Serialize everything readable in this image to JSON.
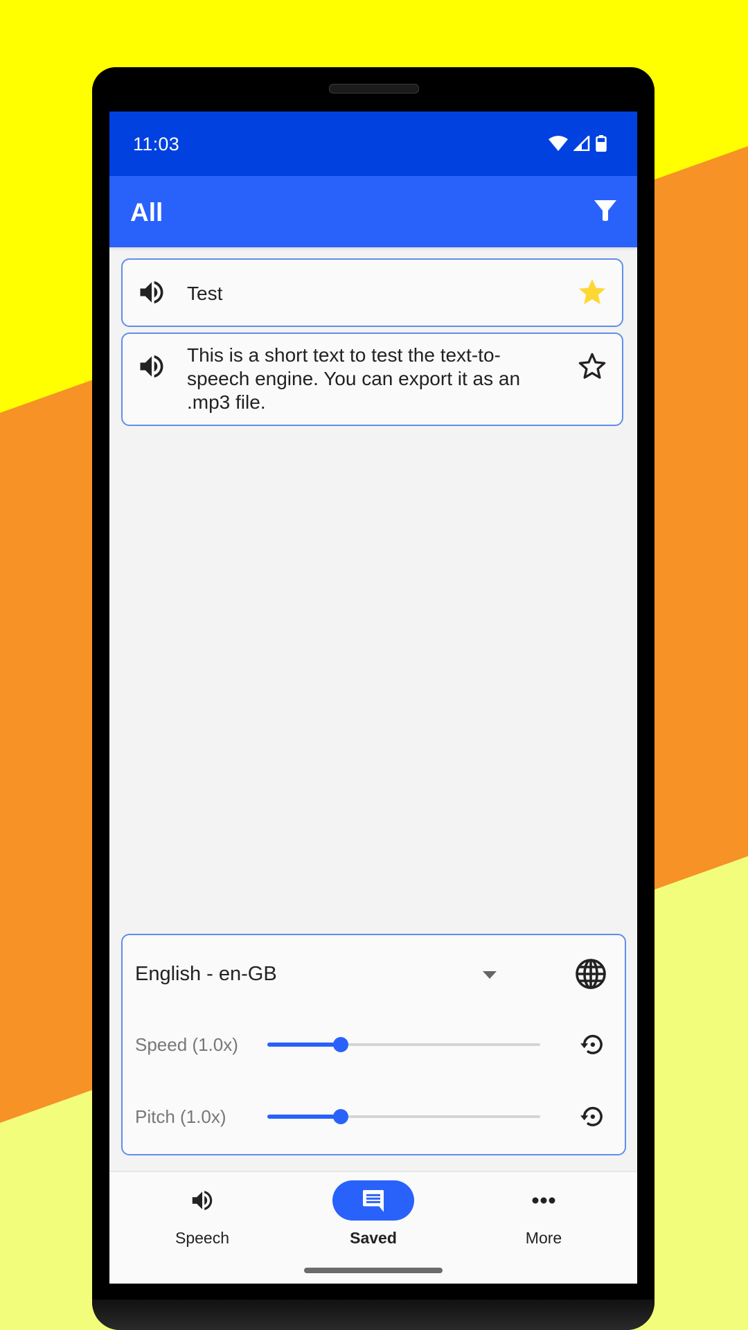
{
  "background": {
    "colors": {
      "top": "#FFFF00",
      "middle": "#F79226",
      "bottom": "#F2FD7C"
    }
  },
  "status_bar": {
    "time": "11:03",
    "icons": [
      "wifi-icon",
      "cellular-signal-icon",
      "battery-icon"
    ]
  },
  "app_bar": {
    "title": "All",
    "filter_icon": "filter-icon"
  },
  "saved_items": [
    {
      "text": "Test",
      "starred": true
    },
    {
      "text": "This is a short text to test the text-to-speech engine. You can export it as an .mp3 file.",
      "starred": false
    }
  ],
  "settings_panel": {
    "language": "English - en-GB",
    "speed": {
      "label": "Speed (1.0x)",
      "value": 1.0,
      "fraction": 0.27
    },
    "pitch": {
      "label": "Pitch (1.0x)",
      "value": 1.0,
      "fraction": 0.27
    }
  },
  "bottom_nav": {
    "items": [
      {
        "label": "Speech",
        "icon": "speaker-icon",
        "active": false
      },
      {
        "label": "Saved",
        "icon": "message-icon",
        "active": true
      },
      {
        "label": "More",
        "icon": "more-horizontal-icon",
        "active": false
      }
    ]
  },
  "colors": {
    "status_bar": "#0041E0",
    "app_bar": "#2962FB",
    "accent": "#2962FB",
    "card_border": "#5E8EEB",
    "star_filled": "#FDD835"
  }
}
